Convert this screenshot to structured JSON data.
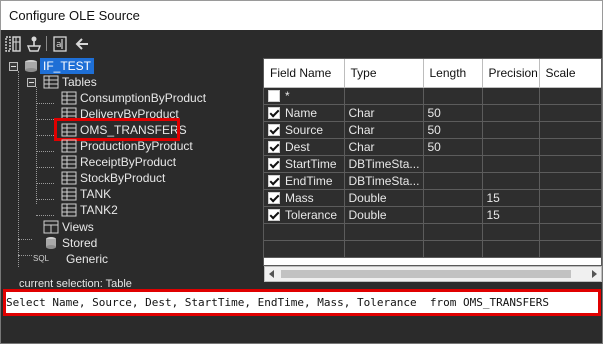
{
  "window": {
    "title": "Configure OLE Source"
  },
  "toolbar": {
    "icons": [
      "split-view-icon",
      "connect-icon",
      "properties-icon",
      "back-arrow-icon"
    ]
  },
  "tree": {
    "root": "IF_TEST",
    "tables_label": "Tables",
    "tables": [
      "ConsumptionByProduct",
      "DeliveryByProduct",
      "OMS_TRANSFERS",
      "ProductionByProduct",
      "ReceiptByProduct",
      "StockByProduct",
      "TANK",
      "TANK2"
    ],
    "highlighted_table": "OMS_TRANSFERS",
    "views_label": "Views",
    "stored_label": "Stored",
    "generic_label": "Generic",
    "sql_icon_text": "SQL"
  },
  "grid": {
    "headers": [
      "Field Name",
      "Type",
      "Length",
      "Precision",
      "Scale"
    ],
    "rows": [
      {
        "checked": false,
        "name": "*",
        "type": "",
        "length": "",
        "precision": "",
        "scale": ""
      },
      {
        "checked": true,
        "name": "Name",
        "type": "Char",
        "length": "50",
        "precision": "",
        "scale": ""
      },
      {
        "checked": true,
        "name": "Source",
        "type": "Char",
        "length": "50",
        "precision": "",
        "scale": ""
      },
      {
        "checked": true,
        "name": "Dest",
        "type": "Char",
        "length": "50",
        "precision": "",
        "scale": ""
      },
      {
        "checked": true,
        "name": "StartTime",
        "type": "DBTimeSta...",
        "length": "",
        "precision": "",
        "scale": ""
      },
      {
        "checked": true,
        "name": "EndTime",
        "type": "DBTimeSta...",
        "length": "",
        "precision": "",
        "scale": ""
      },
      {
        "checked": true,
        "name": "Mass",
        "type": "Double",
        "length": "",
        "precision": "15",
        "scale": ""
      },
      {
        "checked": true,
        "name": "Tolerance",
        "type": "Double",
        "length": "",
        "precision": "15",
        "scale": ""
      }
    ]
  },
  "status": {
    "text": "current selection:  Table"
  },
  "sql": {
    "text": "Select Name, Source, Dest, StartTime, EndTime, Mass, Tolerance  from OMS_TRANSFERS"
  },
  "colors": {
    "highlight_red": "#e00000",
    "selection_blue": "#1e6fd6",
    "panel_dark": "#2b2b2b"
  }
}
